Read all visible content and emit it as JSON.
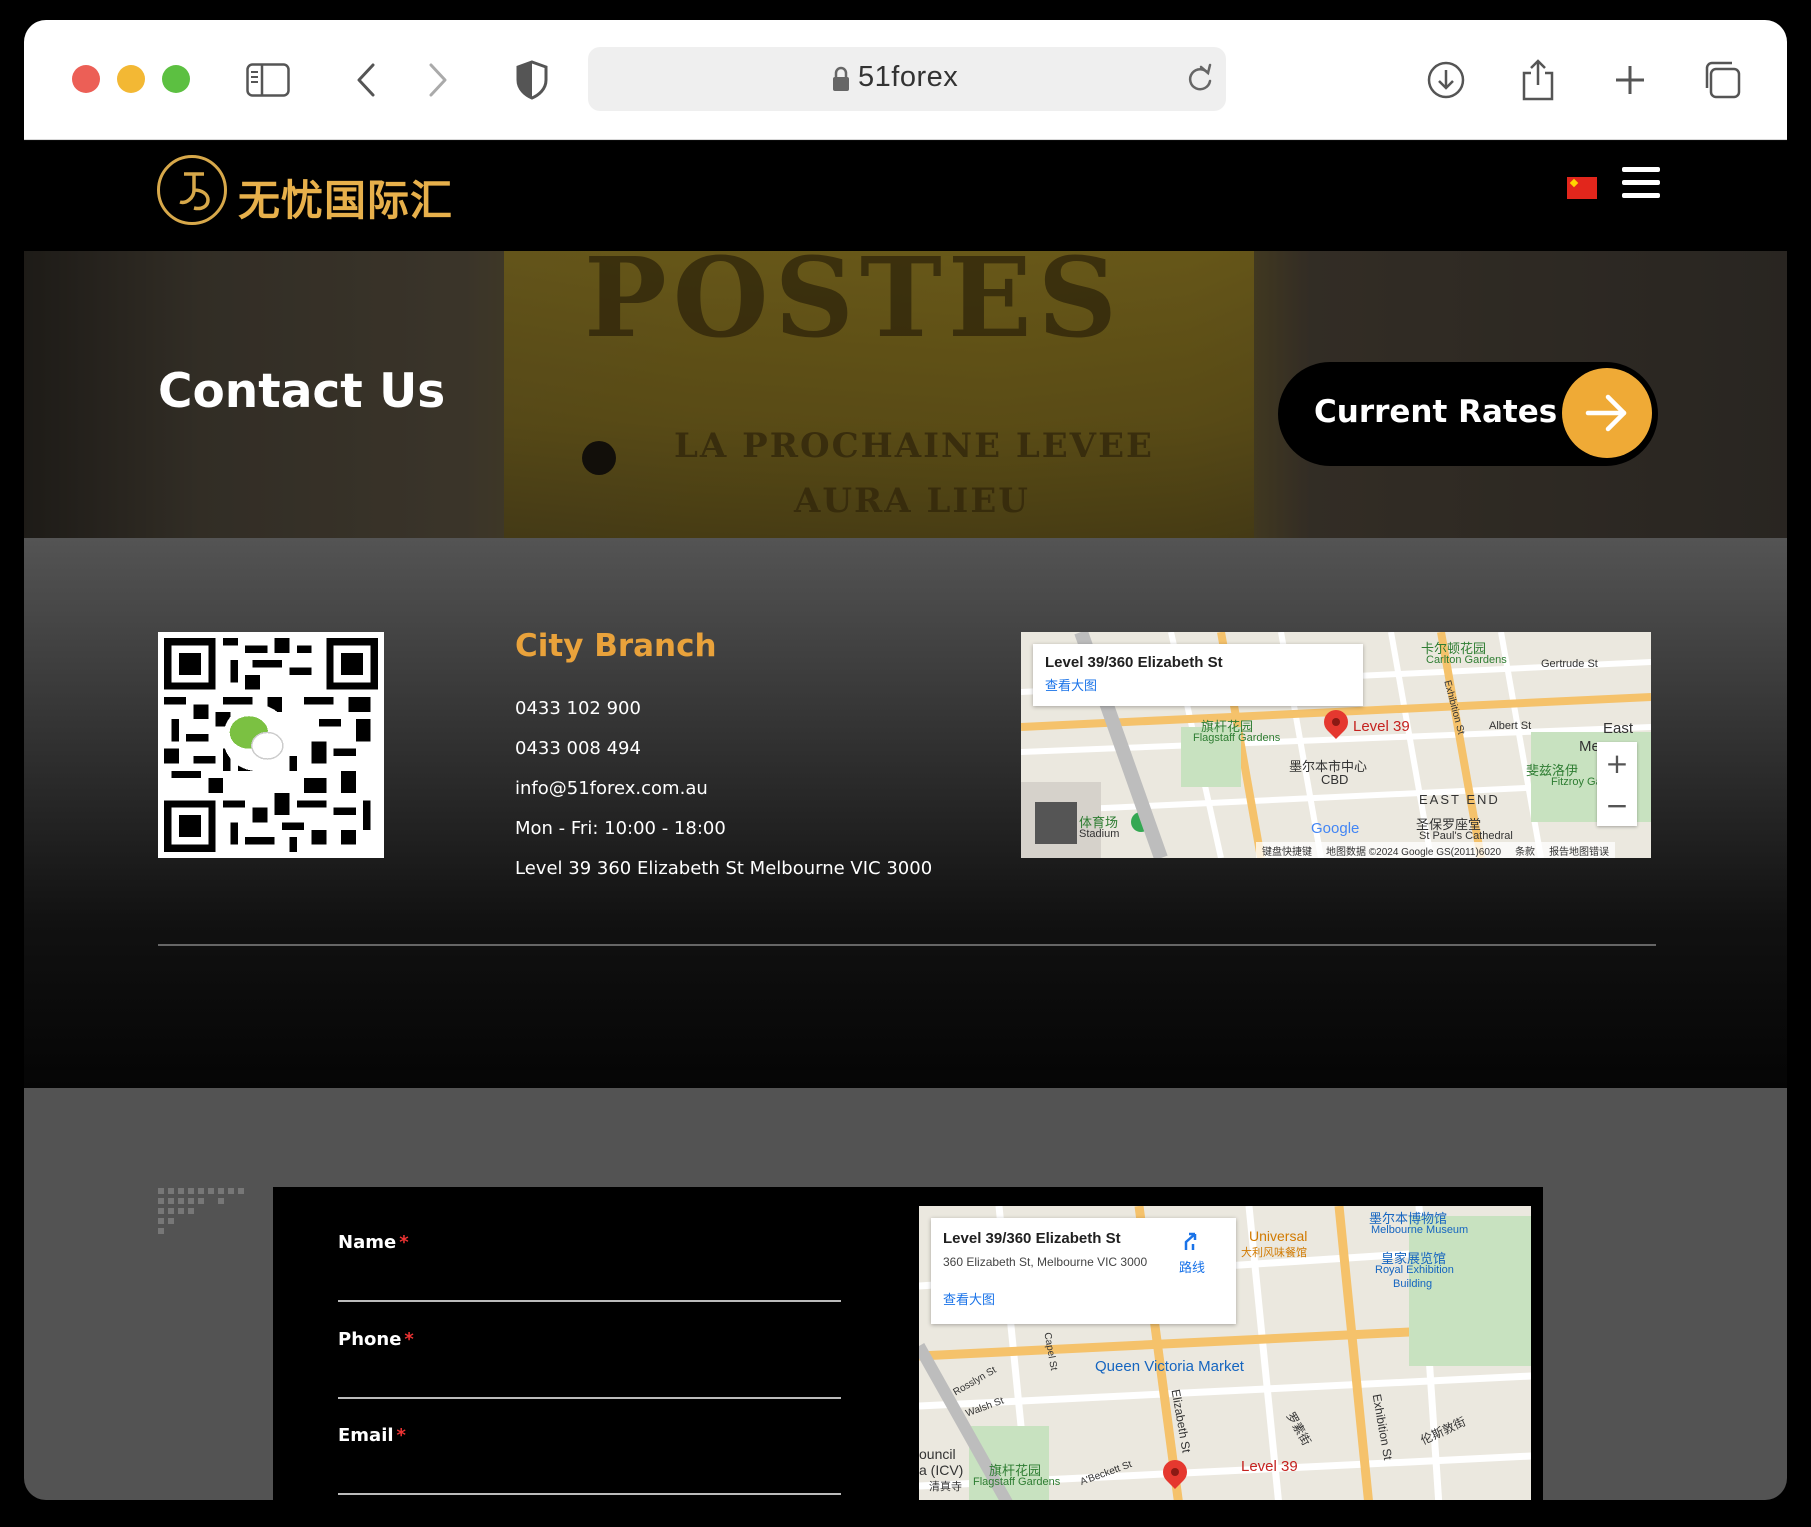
{
  "browser": {
    "url": "51forex"
  },
  "header": {
    "logo_text": "无忧国际汇"
  },
  "hero": {
    "title": "Contact Us",
    "rates_button": "Current Rates",
    "photo_text_line1": "POSTES",
    "photo_text_line2": "LA PROCHAINE LEVEE",
    "photo_text_line3": "AURA LIEU"
  },
  "branch": {
    "title": "City Branch",
    "phone1": "0433 102 900",
    "phone2": "0433 008 494",
    "email": "info@51forex.com.au",
    "hours": "Mon - Fri: 10:00 - 18:00",
    "address": "Level 39 360 Elizabeth St Melbourne VIC 3000"
  },
  "map_small": {
    "card_title": "Level 39/360 Elizabeth St",
    "card_link": "查看大图",
    "pin_label": "Level 39",
    "labels": [
      "卡尔顿花园",
      "Carlton Gardens",
      "Gertrude St",
      "旗杆花园",
      "Flagstaff Gardens",
      "墨尔本市中心",
      "CBD",
      "Exhibition St",
      "Albert St",
      "斐兹洛伊",
      "Fitzroy Gardens",
      "EAST END",
      "圣保罗座堂",
      "St Paul's Cathedral",
      "体育场",
      "Stadium",
      "East",
      "Me"
    ],
    "footer": [
      "键盘快捷键",
      "地图数据 ©2024 Google GS(2011)6020",
      "条款",
      "报告地图错误"
    ],
    "google": "Google"
  },
  "form": {
    "name_label": "Name",
    "phone_label": "Phone",
    "email_label": "Email",
    "required_mark": "*"
  },
  "map_big": {
    "card_title": "Level 39/360 Elizabeth St",
    "card_address": "360 Elizabeth St, Melbourne VIC 3000",
    "card_directions": "路线",
    "card_link": "查看大图",
    "pin_label": "Level 39",
    "labels": [
      "墨尔本博物馆",
      "Melbourne Museum",
      "Universal",
      "大利风味餐馆",
      "皇家展览馆",
      "Royal Exhibition",
      "Building",
      "Queen Victoria Market",
      "Elizabeth St",
      "Exhibition St",
      "罗素街",
      "伦斯敦街",
      "Capel St",
      "Rosslyn St",
      "Walsh St",
      "A'Beckett St",
      "旗杆花园",
      "Flagstaff Gardens",
      "ouncil",
      "a (ICV)",
      "清真寺"
    ]
  },
  "colors": {
    "accent_orange": "#efaa36",
    "branch_title": "#e9a23b",
    "logo_gold": "#e7b04b"
  }
}
